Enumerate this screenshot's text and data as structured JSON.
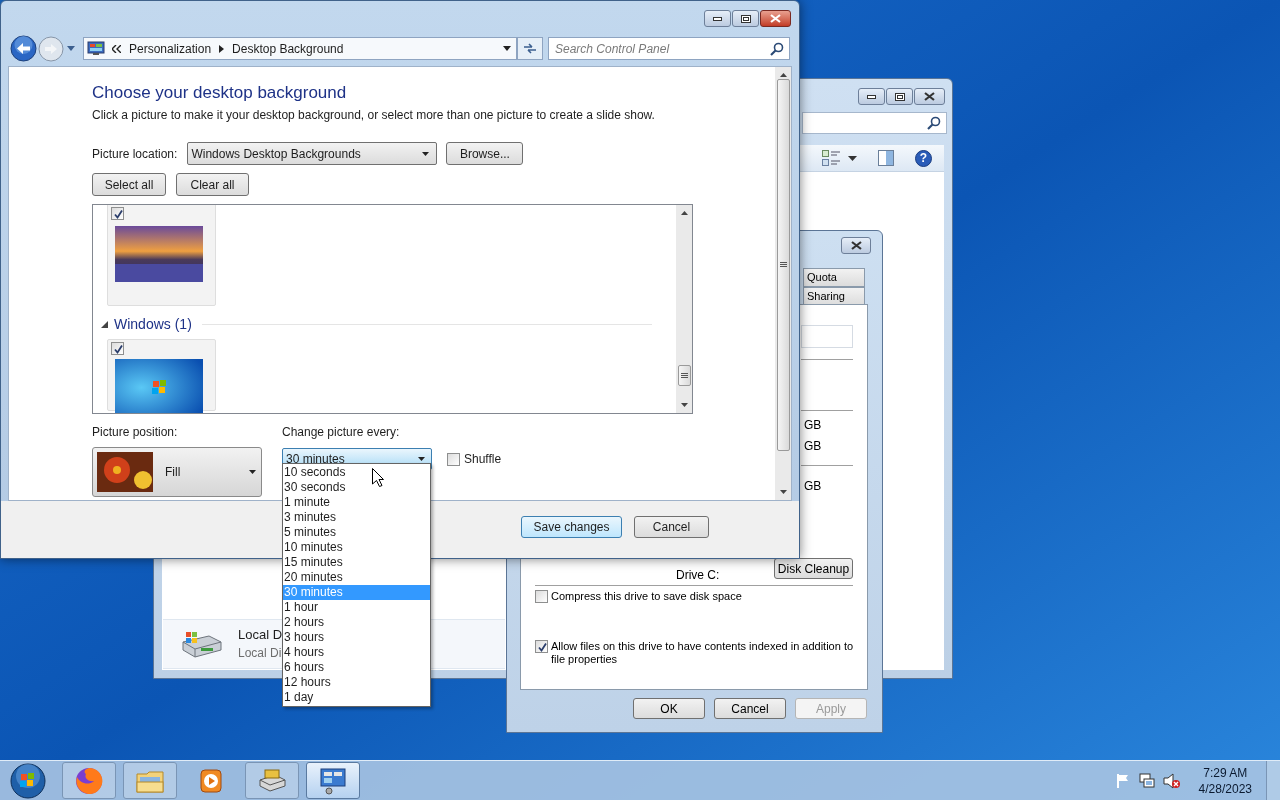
{
  "main_window": {
    "address": {
      "crumbs": [
        "Personalization",
        "Desktop Background"
      ]
    },
    "search": {
      "placeholder": "Search Control Panel"
    },
    "heading": "Choose your desktop background",
    "description": "Click a picture to make it your desktop background, or select more than one picture to create a slide show.",
    "picture_location": {
      "label": "Picture location:",
      "value": "Windows Desktop Backgrounds"
    },
    "browse_button": "Browse...",
    "select_all_button": "Select all",
    "clear_all_button": "Clear all",
    "picture_groups": [
      {
        "items": [
          {
            "kind": "sunset",
            "checked": true
          }
        ]
      },
      {
        "title": "Windows (1)",
        "expanded": true,
        "items": [
          {
            "kind": "logo",
            "checked": true
          }
        ]
      }
    ],
    "picture_position": {
      "label": "Picture position:",
      "value": "Fill"
    },
    "change_interval": {
      "label": "Change picture every:",
      "value": "30 minutes",
      "expanded": true,
      "options": [
        {
          "label": "10 seconds",
          "selected": false
        },
        {
          "label": "30 seconds",
          "selected": false
        },
        {
          "label": "1 minute",
          "selected": false
        },
        {
          "label": "3 minutes",
          "selected": false
        },
        {
          "label": "5 minutes",
          "selected": false
        },
        {
          "label": "10 minutes",
          "selected": false
        },
        {
          "label": "15 minutes",
          "selected": false
        },
        {
          "label": "20 minutes",
          "selected": false
        },
        {
          "label": "30 minutes",
          "selected": true
        },
        {
          "label": "1 hour",
          "selected": false
        },
        {
          "label": "2 hours",
          "selected": false
        },
        {
          "label": "3 hours",
          "selected": false
        },
        {
          "label": "4 hours",
          "selected": false
        },
        {
          "label": "6 hours",
          "selected": false
        },
        {
          "label": "12 hours",
          "selected": false
        },
        {
          "label": "1 day",
          "selected": false
        }
      ]
    },
    "shuffle": {
      "label": "Shuffle",
      "checked": false
    },
    "buttons": [
      {
        "label": "Save changes",
        "default": true
      },
      {
        "label": "Cancel",
        "default": false
      }
    ]
  },
  "properties_dialog": {
    "tabs": [
      {
        "label": "Quota",
        "selected": false
      },
      {
        "label": "Sharing",
        "selected": false
      }
    ],
    "sizes": [
      "GB",
      "GB",
      "GB"
    ],
    "drive_label": "Drive C:",
    "disk_cleanup_button": "Disk Cleanup",
    "options": [
      {
        "label": "Compress this drive to save disk space",
        "checked": false
      },
      {
        "label": "Allow files on this drive to have contents indexed in addition to file properties",
        "checked": true
      }
    ],
    "buttons": [
      {
        "label": "OK",
        "disabled": false
      },
      {
        "label": "Cancel",
        "disabled": false
      },
      {
        "label": "Apply",
        "disabled": true
      }
    ]
  },
  "explorer_window": {
    "help_button": "?",
    "drive": {
      "name": "Local D",
      "description": "Local Di"
    }
  },
  "taskbar": {
    "apps": [
      {
        "kind": "firefox",
        "running": true,
        "active": false
      },
      {
        "kind": "explorer",
        "running": true,
        "active": false
      },
      {
        "kind": "media",
        "running": false,
        "active": false
      },
      {
        "kind": "drive",
        "running": true,
        "active": false
      },
      {
        "kind": "control-panel",
        "running": true,
        "active": true
      }
    ],
    "clock": {
      "time": "7:29 AM",
      "date": "4/28/2023"
    }
  }
}
